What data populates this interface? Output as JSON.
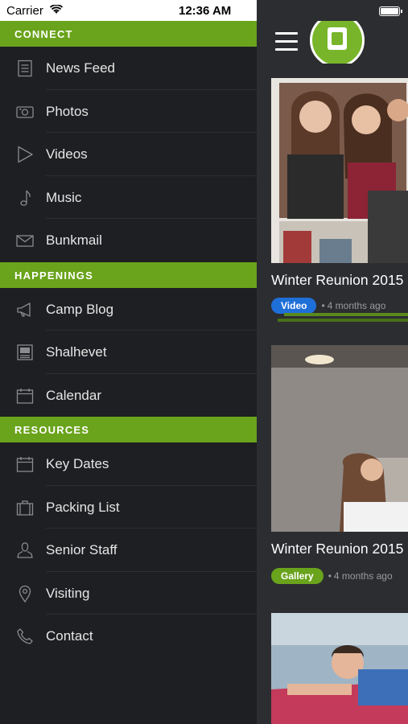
{
  "status_bar": {
    "carrier": "Carrier",
    "time": "12:36 AM"
  },
  "drawer": {
    "sections": [
      {
        "header": "CONNECT",
        "items": [
          {
            "label": "News Feed",
            "icon": "document-icon"
          },
          {
            "label": "Photos",
            "icon": "camera-icon"
          },
          {
            "label": "Videos",
            "icon": "play-icon"
          },
          {
            "label": "Music",
            "icon": "music-note-icon"
          },
          {
            "label": "Bunkmail",
            "icon": "envelope-icon"
          }
        ]
      },
      {
        "header": "HAPPENINGS",
        "items": [
          {
            "label": "Camp Blog",
            "icon": "megaphone-icon"
          },
          {
            "label": "Shalhevet",
            "icon": "newspaper-icon"
          },
          {
            "label": "Calendar",
            "icon": "calendar-icon"
          }
        ]
      },
      {
        "header": "RESOURCES",
        "items": [
          {
            "label": "Key Dates",
            "icon": "calendar-icon"
          },
          {
            "label": "Packing List",
            "icon": "suitcase-icon"
          },
          {
            "label": "Senior Staff",
            "icon": "person-icon"
          },
          {
            "label": "Visiting",
            "icon": "location-pin-icon"
          },
          {
            "label": "Contact",
            "icon": "phone-icon"
          }
        ]
      }
    ]
  },
  "feed": {
    "cards": [
      {
        "title": "Winter Reunion 2015",
        "badge": "Video",
        "time_ago": "4 months ago"
      },
      {
        "title": "Winter Reunion 2015",
        "badge": "Gallery",
        "time_ago": "4 months ago"
      },
      {
        "title": "",
        "badge": "",
        "time_ago": ""
      }
    ]
  },
  "colors": {
    "accent_green": "#6aa31c",
    "video_blue": "#1f6fd8",
    "drawer_bg": "#1e1f22",
    "main_bg": "#2c2d31"
  }
}
